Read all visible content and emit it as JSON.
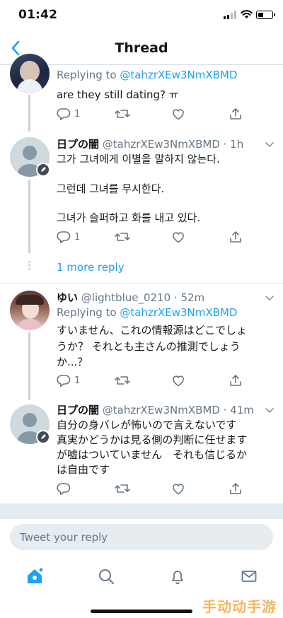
{
  "status_bar": {
    "time": "01:42"
  },
  "nav": {
    "title": "Thread"
  },
  "tweets": [
    {
      "replying_prefix": "Replying to",
      "replying_handle": "@tahzrXEw3NmXBMD",
      "text": "are they still dating? ㅠ",
      "reply_count": "1",
      "retweet_count": "",
      "like_count": ""
    },
    {
      "name": "日プの闇",
      "handle_time": "@tahzrXEw3NmXBMD · 1h",
      "lines": [
        "그가 그녀에게 이별을 말하지 않는다.",
        "그런데 그녀를 무시한다.",
        "그녀가 슬퍼하고 화를 내고 있다."
      ],
      "reply_count": "1",
      "more_replies": "1 more reply"
    },
    {
      "name": "ゆい",
      "handle_time": "@lightblue_0210 · 52m",
      "replying_prefix": "Replying to",
      "replying_handle": "@tahzrXEw3NmXBMD",
      "lines": [
        "すいません、これの情報源はどこでしょ",
        "うか？ それとも主さんの推測でしょう",
        "か...？"
      ],
      "reply_count": "1"
    },
    {
      "name": "日プの闇",
      "handle_time": "@tahzrXEw3NmXBMD · 41m",
      "lines": [
        "自分の身バレが怖いので言えないです",
        "真実かどうかは見る側の判断に任せます",
        "が嘘はついていません　それも信じるか",
        "は自由です"
      ]
    }
  ],
  "composer": {
    "placeholder": "Tweet your reply"
  },
  "tabs": [
    "home-icon",
    "search-icon",
    "notifications-icon",
    "messages-icon"
  ],
  "watermark": "手动动手游",
  "colors": {
    "accent": "#1da1f2",
    "muted": "#657786",
    "thread_line": "#c9d1d8"
  }
}
